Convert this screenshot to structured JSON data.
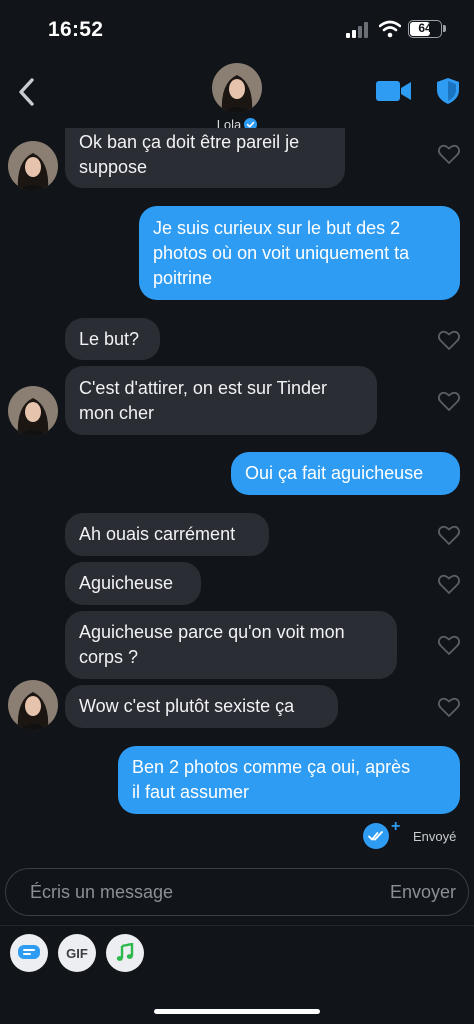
{
  "status_bar": {
    "time": "16:52",
    "battery": "64"
  },
  "header": {
    "name": "Lola",
    "verified": true,
    "video_icon": "video-camera-icon",
    "safety_icon": "shield-icon"
  },
  "messages": [
    {
      "side": "in",
      "text": "Ok ban ça doit être pareil je\nsuppose"
    },
    {
      "side": "out",
      "text": "Je suis curieux sur le but des 2\nphotos où on voit uniquement ta\npoitrine"
    },
    {
      "side": "in",
      "text": "Le but?"
    },
    {
      "side": "in",
      "text": "C'est d'attirer, on est sur Tinder\nmon cher"
    },
    {
      "side": "out",
      "text": "Oui ça fait aguicheuse"
    },
    {
      "side": "in",
      "text": "Ah ouais carrément"
    },
    {
      "side": "in",
      "text": "Aguicheuse"
    },
    {
      "side": "in",
      "text": "Aguicheuse parce qu'on voit mon\ncorps ?"
    },
    {
      "side": "in",
      "text": "Wow c'est plutôt sexiste ça"
    },
    {
      "side": "out",
      "text": "Ben 2 photos comme ça oui, après\nil faut assumer"
    }
  ],
  "delivery_status": "Envoyé",
  "composer": {
    "placeholder": "Écris un message",
    "send_label": "Envoyer"
  },
  "toolbar": {
    "gif_label": "GIF",
    "sticker_icon": "chat-sticker-icon",
    "music_icon": "music-note-icon"
  },
  "colors": {
    "background": "#111418",
    "incoming": "#2a2d33",
    "outgoing": "#2f9cf4",
    "accent": "#2f9cf4"
  }
}
